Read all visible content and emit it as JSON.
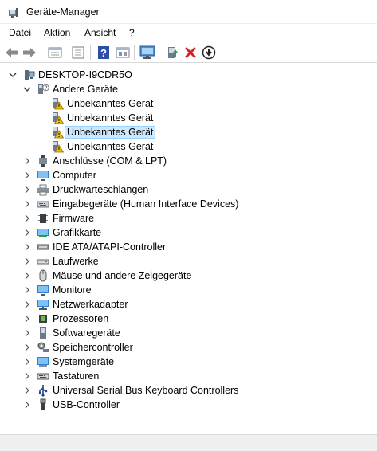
{
  "window": {
    "title": "Geräte-Manager"
  },
  "menu": {
    "items": [
      "Datei",
      "Aktion",
      "Ansicht",
      "?"
    ]
  },
  "toolbar": {
    "buttons": [
      "back-arrow-icon",
      "forward-arrow-icon",
      "properties-icon",
      "list-view-icon",
      "help-icon",
      "resource-view-icon",
      "monitor-scan-icon",
      "update-driver-icon",
      "uninstall-icon",
      "disable-device-icon"
    ]
  },
  "tree": {
    "root": "DESKTOP-I9CDR5O",
    "other_devices": {
      "label": "Andere Geräte",
      "children": [
        "Unbekanntes Gerät",
        "Unbekanntes Gerät",
        "Unbekanntes Gerät",
        "Unbekanntes Gerät"
      ],
      "selected_index": 2
    },
    "categories": [
      "Anschlüsse (COM & LPT)",
      "Computer",
      "Druckwarteschlangen",
      "Eingabegeräte (Human Interface Devices)",
      "Firmware",
      "Grafikkarte",
      "IDE ATA/ATAPI-Controller",
      "Laufwerke",
      "Mäuse und andere Zeigegeräte",
      "Monitore",
      "Netzwerkadapter",
      "Prozessoren",
      "Softwaregeräte",
      "Speichercontroller",
      "Systemgeräte",
      "Tastaturen",
      "Universal Serial Bus Keyboard Controllers",
      "USB-Controller"
    ]
  },
  "colors": {
    "selection": "#cce8ff",
    "selection_border": "#99d1ff",
    "warning": "#f2c200",
    "uninstall_red": "#d9201f",
    "help_blue": "#2b4fa8"
  }
}
